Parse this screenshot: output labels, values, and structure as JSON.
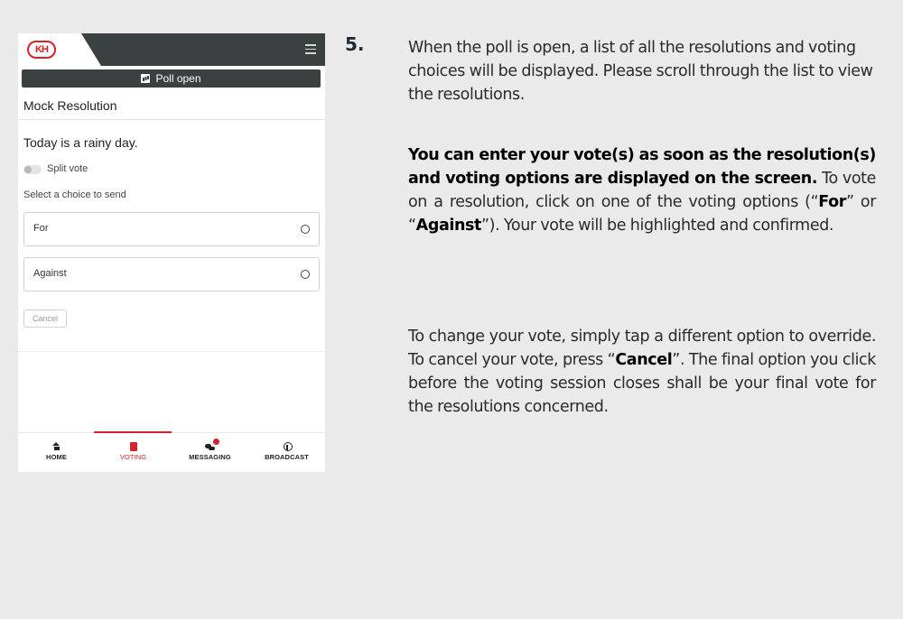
{
  "app": {
    "logo_text": "KH",
    "poll_banner": "Poll open",
    "resolution_title": "Mock Resolution",
    "question": "Today is a rainy day.",
    "split_vote_label": "Split vote",
    "select_label": "Select a choice to send",
    "options": [
      {
        "label": "For"
      },
      {
        "label": "Against"
      }
    ],
    "cancel_label": "Cancel",
    "nav": [
      {
        "label": "HOME",
        "icon": "home-icon",
        "active": false
      },
      {
        "label": "VOTING",
        "icon": "voting-icon",
        "active": true
      },
      {
        "label": "MESSAGING",
        "icon": "messaging-icon",
        "active": false,
        "notification": true
      },
      {
        "label": "BROADCAST",
        "icon": "broadcast-icon",
        "active": false
      }
    ]
  },
  "instructions": {
    "step_number": "5.",
    "p1": "When the poll is open, a list of all the resolutions and voting choices will be displayed. Please scroll through the list to view the resolutions.",
    "p2_bold": "You can enter your vote(s) as soon as the resolution(s) and voting options are displayed on the screen.",
    "p2_a": " To vote on a resolution, click on one of the voting options (“",
    "p2_for": "For",
    "p2_b": "” or “",
    "p2_against": "Against",
    "p2_c": "”). Your vote will be highlighted and confirmed.",
    "p3_a": "To change your vote, simply tap a different option to override. To cancel your vote, press “",
    "p3_cancel": "Cancel",
    "p3_b": "”. The final option you click before the voting session closes shall be your final vote for the resolutions concerned."
  },
  "colors": {
    "accent": "#d8222a",
    "topbar": "#3b4041",
    "background": "#eaeaea"
  }
}
